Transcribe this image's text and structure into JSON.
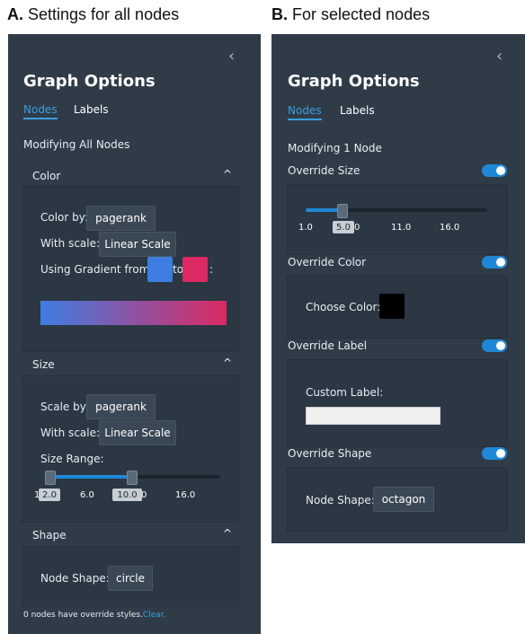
{
  "captions": {
    "a_letter": "A.",
    "a_text": " Settings for all nodes",
    "b_letter": "B.",
    "b_text": " For selected nodes"
  },
  "panel_a": {
    "title": "Graph Options",
    "tabs": [
      "Nodes",
      "Labels"
    ],
    "heading": "Modifying All Nodes",
    "color_section": {
      "label": "Color",
      "caret": "^",
      "color_by_label": "Color by:",
      "color_by_value": "pagerank",
      "scale_label": "With scale:",
      "scale_value": "Linear Scale",
      "gradient_label": "Using Gradient from",
      "to_label": "to",
      "colon": ":",
      "gradient_from": "#3f7de3",
      "gradient_to": "#dc2a62"
    },
    "size_section": {
      "label": "Size",
      "caret": "^",
      "scale_by_label": "Scale by:",
      "scale_by_value": "pagerank",
      "scale_label": "With scale:",
      "scale_value": "Linear Scale",
      "range_label": "Size Range:",
      "range_low": "2.0",
      "range_high": "10.0",
      "ticks": [
        "1",
        "6.0",
        "0",
        "16.0"
      ]
    },
    "shape_section": {
      "label": "Shape",
      "caret": "^",
      "node_shape_label": "Node Shape:",
      "node_shape_value": "circle"
    },
    "footer": {
      "text": "0 nodes have override styles.",
      "link": "Clear."
    }
  },
  "panel_b": {
    "title": "Graph Options",
    "tabs": [
      "Nodes",
      "Labels"
    ],
    "heading": "Modifying 1 Node",
    "override_size": {
      "label": "Override Size",
      "toggle_on": true,
      "value": "5.0",
      "ticks": [
        "1.0",
        "0",
        "11.0",
        "16.0"
      ]
    },
    "override_color": {
      "label": "Override Color",
      "toggle_on": true,
      "choose_label": "Choose Color:",
      "color": "#000000"
    },
    "override_label": {
      "label": "Override Label",
      "toggle_on": true,
      "custom_label": "Custom Label:",
      "value": ""
    },
    "override_shape": {
      "label": "Override Shape",
      "toggle_on": true,
      "node_shape_label": "Node Shape:",
      "node_shape_value": "octagon"
    }
  },
  "icons": {
    "collapse": "chevron-left-icon",
    "section_caret": "chevron-up-icon"
  },
  "colors": {
    "panel_bg": "#2f3c48",
    "accent": "#3b9ddd",
    "toggle": "#1f88d6"
  }
}
